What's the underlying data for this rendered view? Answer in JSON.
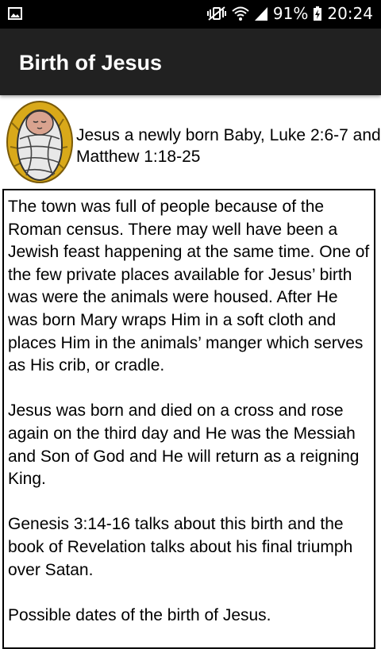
{
  "status_bar": {
    "battery_percent": "91%",
    "time": "20:24",
    "icons": [
      "image-icon",
      "vibrate-muted-icon",
      "wifi-icon",
      "cell-signal-icon",
      "battery-charging-icon"
    ]
  },
  "app_bar": {
    "title": "Birth of Jesus",
    "background_color": "#212121"
  },
  "header": {
    "image_icon": "swaddled-baby-in-manger-icon",
    "heading": "Jesus a newly born Baby, Luke 2:6-7 and Matthew 1:18-25"
  },
  "content": {
    "paragraphs": [
      "The town was full of people because of the Roman census. There may well have been a Jewish feast happening at the same time. One of the few private places available for Jesus’ birth was were the animals were housed. After He was born Mary wraps Him in a soft cloth and places Him in the animals’ manger which serves as His crib, or cradle.",
      "Jesus was born and died on a cross and rose again on the third day and He was the Messiah and Son of God and He will return as a reigning King.",
      "Genesis 3:14-16 talks about this birth and the book of Revelation talks about his final triumph over Satan.",
      "Possible dates of the birth of Jesus."
    ]
  }
}
